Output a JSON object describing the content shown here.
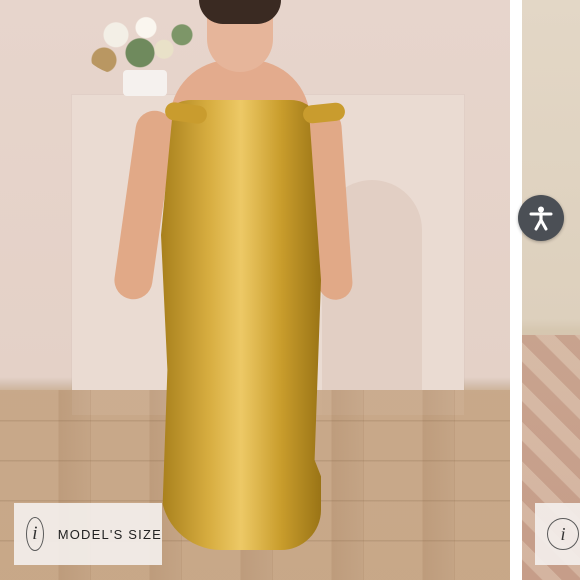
{
  "gallery": {
    "main_slide": {
      "image_alt": "Model in gold satin off-shoulder cowl neck maxi dress",
      "size_button": {
        "info_glyph": "i",
        "label": "MODEL'S SIZE"
      }
    },
    "next_slide": {
      "size_button": {
        "info_glyph": "i"
      }
    }
  },
  "accessibility_button": {
    "icon": "accessibility-person-icon",
    "color": "#4b4f55"
  },
  "colors": {
    "dress": "#d4a83a",
    "backdrop": "#e7d5cc",
    "chip_bg": "#f3efec"
  }
}
